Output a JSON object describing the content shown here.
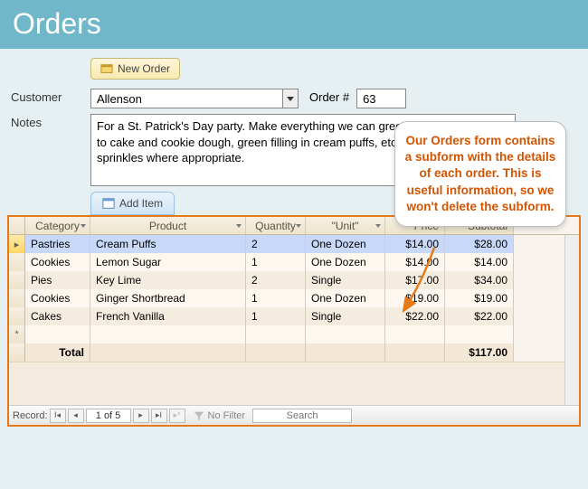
{
  "header": {
    "title": "Orders"
  },
  "toolbar": {
    "new_order": "New Order",
    "add_item": "Add Item"
  },
  "labels": {
    "customer": "Customer",
    "notes": "Notes",
    "order_no": "Order #"
  },
  "fields": {
    "customer": "Allenson",
    "order_no": "63",
    "notes": "For a St. Patrick's Day party. Make everything we can green (add food coloring to cake and cookie dough, green filling in cream puffs, etc.) and add on green sprinkles where appropriate."
  },
  "callout": "Our Orders form contains a subform with the details of each order. This is useful information, so we won't delete the subform.",
  "grid": {
    "columns": [
      "Category",
      "Product",
      "Quantity",
      "\"Unit\"",
      "Price",
      "Subtotal"
    ],
    "rows": [
      {
        "category": "Pastries",
        "product": "Cream Puffs",
        "qty": "2",
        "unit": "One Dozen",
        "price": "$14.00",
        "subtotal": "$28.00",
        "selected": true
      },
      {
        "category": "Cookies",
        "product": "Lemon Sugar",
        "qty": "1",
        "unit": "One Dozen",
        "price": "$14.00",
        "subtotal": "$14.00"
      },
      {
        "category": "Pies",
        "product": "Key Lime",
        "qty": "2",
        "unit": "Single",
        "price": "$17.00",
        "subtotal": "$34.00"
      },
      {
        "category": "Cookies",
        "product": "Ginger Shortbread",
        "qty": "1",
        "unit": "One Dozen",
        "price": "$19.00",
        "subtotal": "$19.00"
      },
      {
        "category": "Cakes",
        "product": "French Vanilla",
        "qty": "1",
        "unit": "Single",
        "price": "$22.00",
        "subtotal": "$22.00"
      }
    ],
    "total_label": "Total",
    "total_value": "$117.00"
  },
  "nav": {
    "label": "Record:",
    "position": "1 of 5",
    "no_filter": "No Filter",
    "search_placeholder": "Search"
  }
}
